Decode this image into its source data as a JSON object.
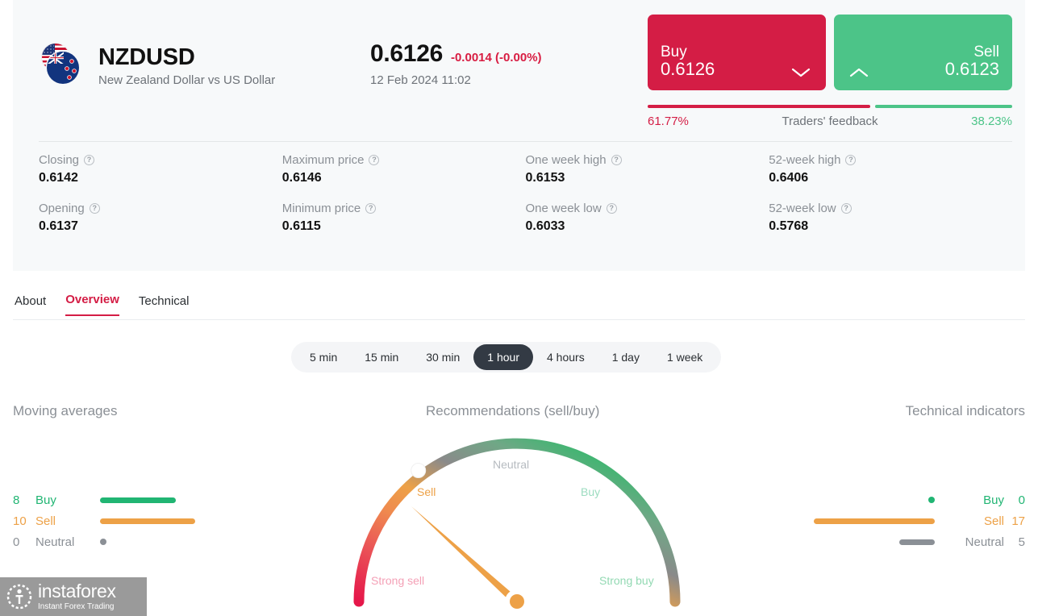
{
  "instrument": {
    "symbol": "NZDUSD",
    "description": "New Zealand Dollar vs US Dollar",
    "flag_icon": "nzd-usd-flags-icon"
  },
  "quote": {
    "last_price": "0.6126",
    "change": "-0.0014 (-0.00%)",
    "timestamp": "12 Feb 2024 11:02",
    "change_color": "#d81d42"
  },
  "trade": {
    "buy_label": "Buy",
    "buy_price": "0.6126",
    "sell_label": "Sell",
    "sell_price": "0.6123",
    "buy_color": "#d41d45",
    "sell_color": "#4cc488"
  },
  "feedback": {
    "title": "Traders' feedback",
    "buy_pct_label": "61.77%",
    "sell_pct_label": "38.23%",
    "buy_pct": 61.77,
    "sell_pct": 38.23
  },
  "stats": [
    {
      "label": "Closing",
      "value": "0.6142"
    },
    {
      "label": "Maximum price",
      "value": "0.6146"
    },
    {
      "label": "One week high",
      "value": "0.6153"
    },
    {
      "label": "52-week high",
      "value": "0.6406"
    },
    {
      "label": "Opening",
      "value": "0.6137"
    },
    {
      "label": "Minimum price",
      "value": "0.6115"
    },
    {
      "label": "One week low",
      "value": "0.6033"
    },
    {
      "label": "52-week low",
      "value": "0.5768"
    }
  ],
  "tabs": [
    {
      "label": "About",
      "active": false
    },
    {
      "label": "Overview",
      "active": true
    },
    {
      "label": "Technical",
      "active": false
    }
  ],
  "timeframes": [
    {
      "label": "5 min",
      "active": false
    },
    {
      "label": "15 min",
      "active": false
    },
    {
      "label": "30 min",
      "active": false
    },
    {
      "label": "1 hour",
      "active": true
    },
    {
      "label": "4 hours",
      "active": false
    },
    {
      "label": "1 day",
      "active": false
    },
    {
      "label": "1 week",
      "active": false
    }
  ],
  "moving_averages": {
    "title": "Moving averages",
    "rows": [
      {
        "count": "8",
        "name": "Buy",
        "value": 8,
        "color": "#21b573"
      },
      {
        "count": "10",
        "name": "Sell",
        "value": 10,
        "color": "#eda147"
      },
      {
        "count": "0",
        "name": "Neutral",
        "value": 0,
        "color": "#8b9096"
      }
    ]
  },
  "technical_indicators": {
    "title": "Technical indicators",
    "rows": [
      {
        "count": "0",
        "name": "Buy",
        "value": 0,
        "color": "#21b573"
      },
      {
        "count": "17",
        "name": "Sell",
        "value": 17,
        "color": "#eda147"
      },
      {
        "count": "5",
        "name": "Neutral",
        "value": 5,
        "color": "#8b9096"
      }
    ]
  },
  "recommendations": {
    "title": "Recommendations (sell/buy)",
    "labels": {
      "strong_sell": "Strong sell",
      "sell": "Sell",
      "neutral": "Neutral",
      "buy": "Buy",
      "strong_buy": "Strong buy"
    },
    "needle_zone": "Sell",
    "needle_angle_deg": -56,
    "marker_angle_deg": -56
  },
  "watermark": {
    "name": "instaforex",
    "tagline": "Instant Forex Trading"
  },
  "chart_data": {
    "type": "gauge",
    "title": "Recommendations (sell/buy)",
    "zones": [
      "Strong sell",
      "Sell",
      "Neutral",
      "Buy",
      "Strong buy"
    ],
    "needle_zone": "Sell",
    "summary_panels": [
      {
        "type": "bar",
        "title": "Moving averages",
        "categories": [
          "Buy",
          "Sell",
          "Neutral"
        ],
        "values": [
          8,
          10,
          0
        ],
        "colors": [
          "#21b573",
          "#eda147",
          "#8b9096"
        ]
      },
      {
        "type": "bar",
        "title": "Technical indicators",
        "categories": [
          "Buy",
          "Sell",
          "Neutral"
        ],
        "values": [
          0,
          17,
          5
        ],
        "colors": [
          "#21b573",
          "#eda147",
          "#8b9096"
        ]
      },
      {
        "type": "bar",
        "title": "Traders' feedback",
        "categories": [
          "Buy",
          "Sell"
        ],
        "values": [
          61.77,
          38.23
        ],
        "colors": [
          "#d41d45",
          "#4cc488"
        ]
      }
    ]
  }
}
